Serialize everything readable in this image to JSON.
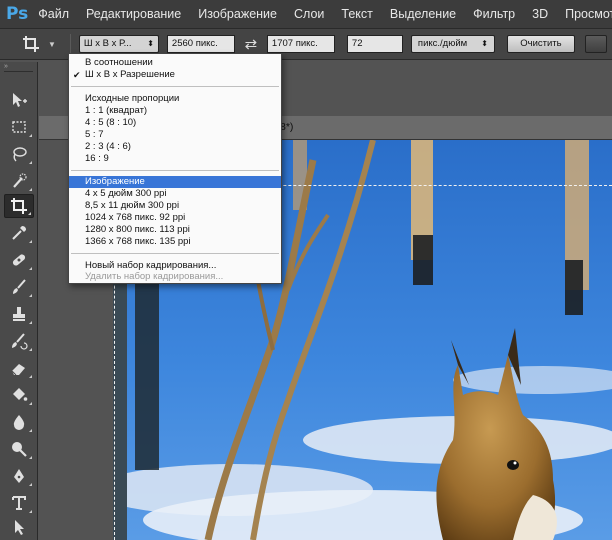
{
  "app": {
    "logo": "Ps",
    "menu": [
      "Файл",
      "Редактирование",
      "Изображение",
      "Слои",
      "Текст",
      "Выделение",
      "Фильтр",
      "3D",
      "Просмотр"
    ]
  },
  "options": {
    "preset_label": "Ш x В x Р...",
    "width_value": "2560 пикс.",
    "height_value": "1707 пикс.",
    "resolution_value": "72",
    "resolution_unit": "пикс./дюйм",
    "clear_label": "Очистить"
  },
  "document": {
    "tab_label_visible": "8*)"
  },
  "dropdown": {
    "group1": [
      "В соотношении",
      "Ш x В x Разрешение"
    ],
    "checked_item": "Ш x В x Разрешение",
    "group2": [
      "Исходные пропорции",
      "1 : 1 (квадрат)",
      "4 : 5 (8 : 10)",
      "5 : 7",
      "2 : 3 (4 : 6)",
      "16 : 9"
    ],
    "group3": [
      "Изображение",
      "4 x 5 дюйм 300 ppi",
      "8,5 x 11 дюйм 300 ppi",
      "1024 x 768 пикс. 92 ppi",
      "1280 x 800 пикс. 113 ppi",
      "1366 x 768 пикс. 135 ppi"
    ],
    "highlighted_item": "Изображение",
    "group4": [
      "Новый набор кадрирования...",
      "Удалить набор кадрирования..."
    ],
    "disabled_item": "Удалить набор кадрирования..."
  },
  "toolbox": {
    "tools": [
      "move-icon",
      "rectangular-marquee-icon",
      "lasso-icon",
      "quick-selection-icon",
      "crop-icon",
      "eyedropper-icon",
      "healing-brush-icon",
      "brush-icon",
      "clone-stamp-icon",
      "history-brush-icon",
      "eraser-icon",
      "paint-bucket-icon",
      "blur-icon",
      "dodge-icon",
      "pen-icon",
      "type-icon",
      "path-selection-icon"
    ],
    "active_tool": "crop-icon"
  },
  "colors": {
    "menubar": "#3c3c3c",
    "optionsbar": "#444444",
    "highlight": "#3875d7",
    "logo": "#4aa8e8"
  }
}
